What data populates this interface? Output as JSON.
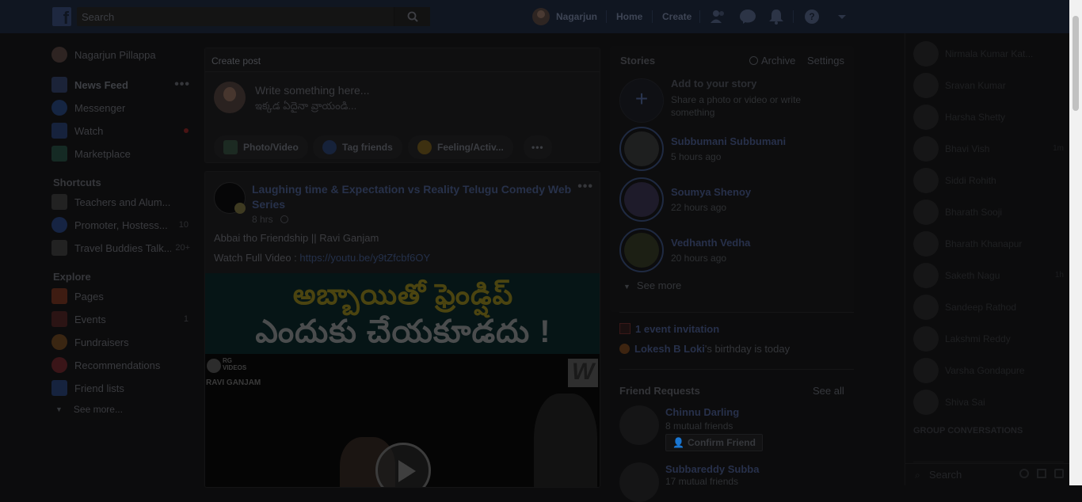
{
  "header": {
    "search_placeholder": "Search",
    "user_name": "Nagarjun",
    "home": "Home",
    "create": "Create"
  },
  "left_nav": {
    "profile": "Nagarjun Pillappa",
    "main": [
      {
        "label": "News Feed",
        "icon": "news-feed-icon"
      },
      {
        "label": "Messenger",
        "icon": "messenger-icon"
      },
      {
        "label": "Watch",
        "icon": "watch-icon"
      },
      {
        "label": "Marketplace",
        "icon": "marketplace-icon"
      }
    ],
    "shortcuts_heading": "Shortcuts",
    "shortcuts": [
      {
        "label": "Teachers and Alum...",
        "count": ""
      },
      {
        "label": "Promoter, Hostess...",
        "count": "10"
      },
      {
        "label": "Travel Buddies Talk...",
        "count": "20+"
      }
    ],
    "explore_heading": "Explore",
    "explore": [
      {
        "label": "Pages",
        "count": ""
      },
      {
        "label": "Events",
        "count": "1"
      },
      {
        "label": "Fundraisers",
        "count": ""
      },
      {
        "label": "Recommendations",
        "count": ""
      },
      {
        "label": "Friend lists",
        "count": ""
      }
    ],
    "see_more": "See more..."
  },
  "composer": {
    "title": "Create post",
    "placeholder_line1": "Write something here...",
    "placeholder_line2": "ఇక్కడ ఏదైనా వ్రాయండి...",
    "actions": [
      {
        "label": "Photo/Video",
        "icon": "photo-video-icon"
      },
      {
        "label": "Tag friends",
        "icon": "tag-friends-icon"
      },
      {
        "label": "Feeling/Activ...",
        "icon": "feeling-icon"
      }
    ]
  },
  "post": {
    "title": "Laughing time & Expectation vs Reality Telugu Comedy Web Series",
    "time": "8 hrs",
    "text": "Abbai tho Friendship || Ravi Ganjam",
    "watch_prefix": "Watch Full Video : ",
    "link": "https://youtu.be/y9tZfcbf6OY",
    "image_line1": "అబ్బాయితో ఫ్రెండ్షిప్",
    "image_line2": "ఎందుకు చేయకూడదు !",
    "watermark_top": "RG\nVIDEOS",
    "watermark_bottom": "RAVI GANJAM",
    "logo_letter": "W"
  },
  "stories": {
    "heading": "Stories",
    "archive": "Archive",
    "settings": "Settings",
    "add_title": "Add to your story",
    "add_subtitle": "Share a photo or video or write something",
    "items": [
      {
        "name": "Subbumani Subbumani",
        "time": "5 hours ago"
      },
      {
        "name": "Soumya Shenoy",
        "time": "22 hours ago"
      },
      {
        "name": "Vedhanth Vedha",
        "time": "20 hours ago"
      }
    ],
    "see_more": "See more"
  },
  "events": {
    "invitation": "1 event invitation",
    "birthday_name": "Lokesh B Loki",
    "birthday_suffix": "'s birthday is today"
  },
  "friend_requests": {
    "heading": "Friend Requests",
    "see_all": "See all",
    "items": [
      {
        "name": "Chinnu Darling",
        "mutual": "8 mutual friends",
        "button": "Confirm Friend"
      },
      {
        "name": "Subbareddy Subba",
        "mutual": "17 mutual friends"
      }
    ]
  },
  "chat": {
    "contacts": [
      {
        "name": "Nirmala Kumar Kat...",
        "time": ""
      },
      {
        "name": "Sravan Kumar",
        "time": ""
      },
      {
        "name": "Harsha Shetty",
        "time": ""
      },
      {
        "name": "Bhavi Vish",
        "time": "1m"
      },
      {
        "name": "Siddi Rohith",
        "time": ""
      },
      {
        "name": "Bharath Sooji",
        "time": ""
      },
      {
        "name": "Bharath Khanapur",
        "time": ""
      },
      {
        "name": "Saketh Nagu",
        "time": "1h"
      },
      {
        "name": "Sandeep Rathod",
        "time": ""
      },
      {
        "name": "Lakshmi Reddy",
        "time": ""
      },
      {
        "name": "Varsha Gondapure",
        "time": ""
      },
      {
        "name": "Shiva Sai",
        "time": ""
      }
    ],
    "group_heading": "GROUP CONVERSATIONS",
    "search_placeholder": "Search"
  }
}
